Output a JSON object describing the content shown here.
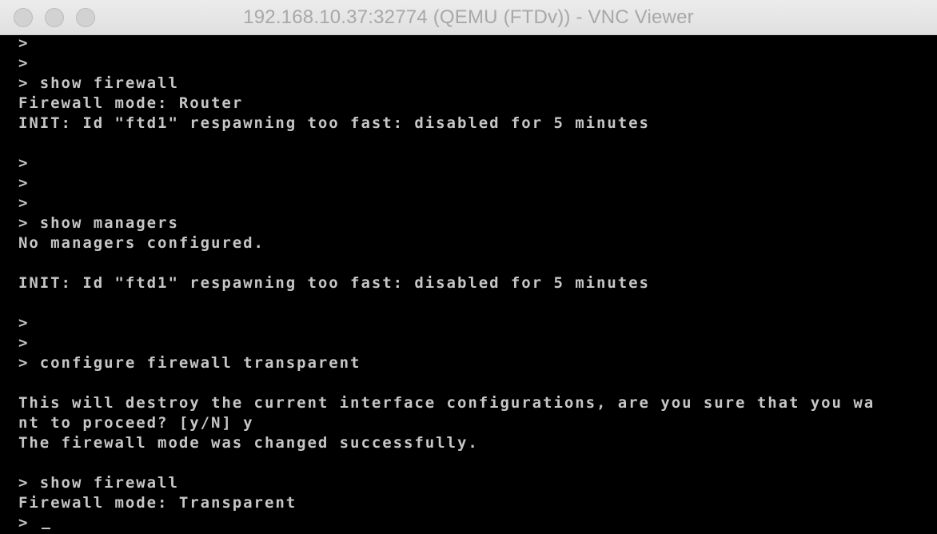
{
  "window": {
    "title": "192.168.10.37:32774 (QEMU (FTDv)) - VNC Viewer"
  },
  "terminal": {
    "lines": [
      ">",
      ">",
      "> show firewall",
      "Firewall mode: Router",
      "INIT: Id \"ftd1\" respawning too fast: disabled for 5 minutes",
      "",
      ">",
      ">",
      ">",
      "> show managers",
      "No managers configured.",
      "",
      "INIT: Id \"ftd1\" respawning too fast: disabled for 5 minutes",
      "",
      ">",
      ">",
      "> configure firewall transparent",
      "",
      "This will destroy the current interface configurations, are you sure that you wa",
      "nt to proceed? [y/N] y",
      "The firewall mode was changed successfully.",
      "",
      "> show firewall",
      "Firewall mode: Transparent"
    ],
    "prompt": "> "
  },
  "colors": {
    "terminal_background": "#000000",
    "terminal_text": "#c6c6c6",
    "titlebar": "#e6e6e6"
  }
}
